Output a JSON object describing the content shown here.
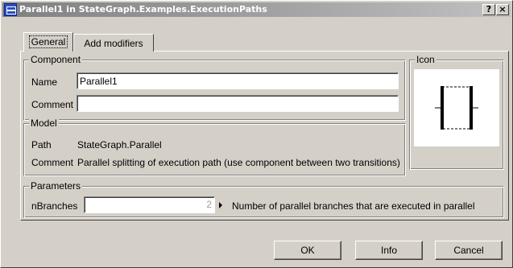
{
  "window": {
    "title": "Parallel1 in StateGraph.Examples.ExecutionPaths",
    "help_label": "?",
    "close_label": "×"
  },
  "tabs": [
    {
      "label": "General",
      "selected": true
    },
    {
      "label": "Add modifiers",
      "selected": false
    }
  ],
  "component": {
    "legend": "Component",
    "name_label": "Name",
    "name_value": "Parallel1",
    "comment_label": "Comment",
    "comment_value": ""
  },
  "icon_group": {
    "legend": "Icon",
    "icon": "parallel-block-icon"
  },
  "model": {
    "legend": "Model",
    "path_label": "Path",
    "path_value": "StateGraph.Parallel",
    "comment_label": "Comment",
    "comment_value": "Parallel splitting of execution path (use component between two transitions)"
  },
  "parameters": {
    "legend": "Parameters",
    "items": [
      {
        "name": "nBranches",
        "value": "2",
        "description": "Number of parallel branches that are executed in parallel"
      }
    ]
  },
  "buttons": {
    "ok": "OK",
    "info": "Info",
    "cancel": "Cancel"
  }
}
